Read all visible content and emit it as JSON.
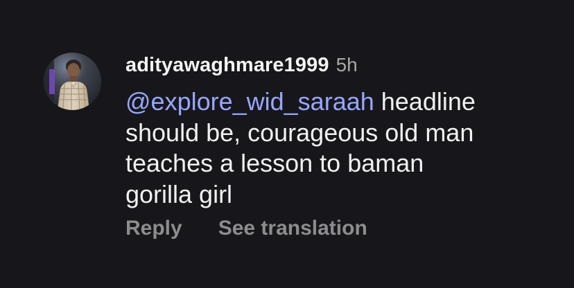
{
  "comment": {
    "username": "adityawaghmare1999",
    "time": "5h",
    "mention": "@explore_wid_saraah",
    "body_lines": [
      " headline",
      "should be, courageous old man",
      "teaches a lesson to baman",
      "gorilla girl"
    ],
    "actions": {
      "reply": "Reply",
      "see_translation": "See translation"
    }
  },
  "colors": {
    "background": "#17171b",
    "mention": "#98a7ff",
    "username": "#f4f4f4",
    "body": "#f1f1f1",
    "muted": "#8d8d8d"
  },
  "icons": {
    "avatar": "user-avatar"
  }
}
